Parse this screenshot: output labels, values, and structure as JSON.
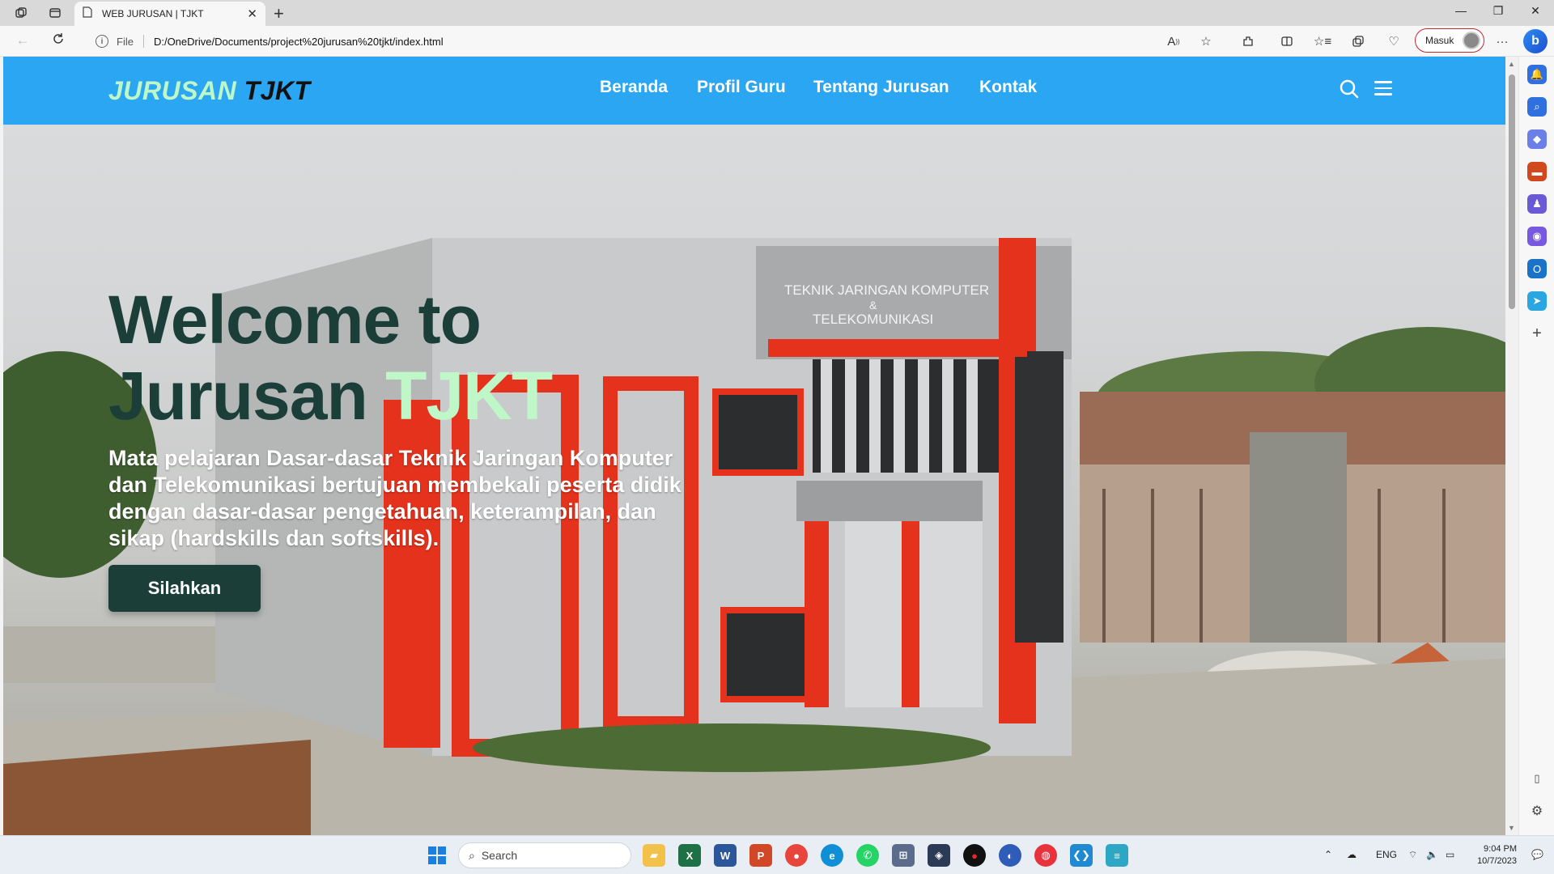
{
  "browser": {
    "tab_title": "WEB JURUSAN | TJKT",
    "url_scheme": "File",
    "url": "D:/OneDrive/Documents/project%20jurusan%20tjkt/index.html",
    "signin_label": "Masuk",
    "colors": {
      "signin_border": "#c4262e",
      "tab_bar": "#d9d9d9"
    }
  },
  "site": {
    "logo_part1": "JURUSAN",
    "logo_part2": "TJKT",
    "nav": [
      "Beranda",
      "Profil Guru",
      "Tentang Jurusan",
      "Kontak"
    ],
    "colors": {
      "header_bg": "#2ba6f3",
      "accent": "#bff7c9",
      "dark": "#1b3f38"
    }
  },
  "hero": {
    "title_line1": "Welcome to",
    "title_line2_a": "Jurusan",
    "title_line2_b": "TJKT",
    "description": "Mata pelajaran Dasar-dasar Teknik Jaringan Komputer dan Telekomunikasi bertujuan membekali peserta didik dengan dasar-dasar pengetahuan, keterampilan, dan sikap (hardskills dan softskills).",
    "cta_label": "Silahkan",
    "building_sign_line1": "TEKNIK JARINGAN KOMPUTER",
    "building_sign_line2": "&",
    "building_sign_line3": "TELEKOMUNIKASI"
  },
  "taskbar": {
    "search_label": "Search",
    "language": "ENG",
    "time": "9:04 PM",
    "date": "10/7/2023"
  }
}
